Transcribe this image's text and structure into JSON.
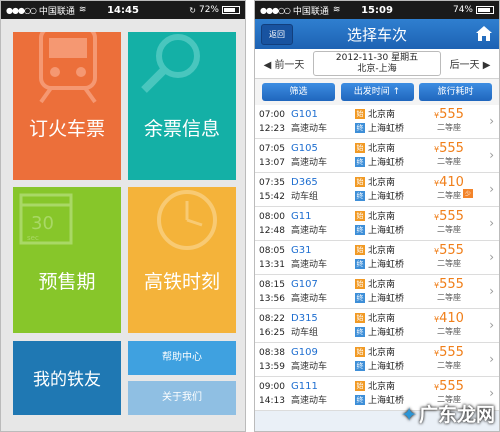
{
  "left_status": {
    "carrier": "中国联通",
    "signal": "●●●○○",
    "wifi": "wifi-icon",
    "time": "14:45",
    "battery": "72%",
    "battery_level": 0.72
  },
  "right_status": {
    "carrier": "中国联通",
    "signal": "●●●○○",
    "wifi": "wifi-icon",
    "time": "15:09",
    "battery": "74%",
    "battery_level": 0.74
  },
  "home_tiles": {
    "book_ticket": "订火车票",
    "remaining_tickets": "余票信息",
    "presale": "预售期",
    "hsr_timetable": "高铁时刻",
    "my_friends": "我的铁友",
    "help": "帮助中心",
    "about": "关于我们"
  },
  "results": {
    "back_label": "返回",
    "title": "选择车次",
    "prev_day": "前一天",
    "next_day": "后一天",
    "date": "2012-11-30 星期五",
    "route": "北京-上海",
    "filter": "筛选",
    "sort_departure": "出发时间 ↑",
    "sort_duration": "旅行耗时",
    "trains": [
      {
        "dep": "07:00",
        "arr": "12:23",
        "num": "G101",
        "type": "高速动车",
        "from_badge": "始",
        "from": "北京南",
        "to_badge": "终",
        "to": "上海虹桥",
        "price": "555",
        "seat": "二等座"
      },
      {
        "dep": "07:05",
        "arr": "13:07",
        "num": "G105",
        "type": "高速动车",
        "from_badge": "始",
        "from": "北京南",
        "to_badge": "终",
        "to": "上海虹桥",
        "price": "555",
        "seat": "二等座"
      },
      {
        "dep": "07:35",
        "arr": "15:42",
        "num": "D365",
        "type": "动车组",
        "from_badge": "始",
        "from": "北京南",
        "to_badge": "终",
        "to": "上海虹桥",
        "price": "410",
        "seat": "二等座",
        "few": "少"
      },
      {
        "dep": "08:00",
        "arr": "12:48",
        "num": "G11",
        "type": "高速动车",
        "from_badge": "始",
        "from": "北京南",
        "to_badge": "终",
        "to": "上海虹桥",
        "price": "555",
        "seat": "二等座"
      },
      {
        "dep": "08:05",
        "arr": "13:31",
        "num": "G31",
        "type": "高速动车",
        "from_badge": "始",
        "from": "北京南",
        "to_badge": "终",
        "to": "上海虹桥",
        "price": "555",
        "seat": "二等座"
      },
      {
        "dep": "08:15",
        "arr": "13:56",
        "num": "G107",
        "type": "高速动车",
        "from_badge": "始",
        "from": "北京南",
        "to_badge": "终",
        "to": "上海虹桥",
        "price": "555",
        "seat": "二等座"
      },
      {
        "dep": "08:22",
        "arr": "16:25",
        "num": "D315",
        "type": "动车组",
        "from_badge": "始",
        "from": "北京南",
        "to_badge": "终",
        "to": "上海虹桥",
        "price": "410",
        "seat": "二等座"
      },
      {
        "dep": "08:38",
        "arr": "13:59",
        "num": "G109",
        "type": "高速动车",
        "from_badge": "始",
        "from": "北京南",
        "to_badge": "终",
        "to": "上海虹桥",
        "price": "555",
        "seat": "二等座"
      },
      {
        "dep": "09:00",
        "arr": "14:13",
        "num": "G111",
        "type": "高速动车",
        "from_badge": "始",
        "from": "北京南",
        "to_badge": "终",
        "to": "上海虹桥",
        "price": "555",
        "seat": "二等座"
      }
    ]
  },
  "watermark": "广东龙网",
  "colors": {
    "orange_tile": "#ec6f3a",
    "teal_tile": "#14b0a6",
    "green_tile": "#87c62a",
    "yellow_tile": "#f4b33a",
    "blue_tile": "#1f78b3",
    "navbar": "#2f7fd0",
    "price": "#f07f1a",
    "train_number": "#1e6ed0"
  }
}
